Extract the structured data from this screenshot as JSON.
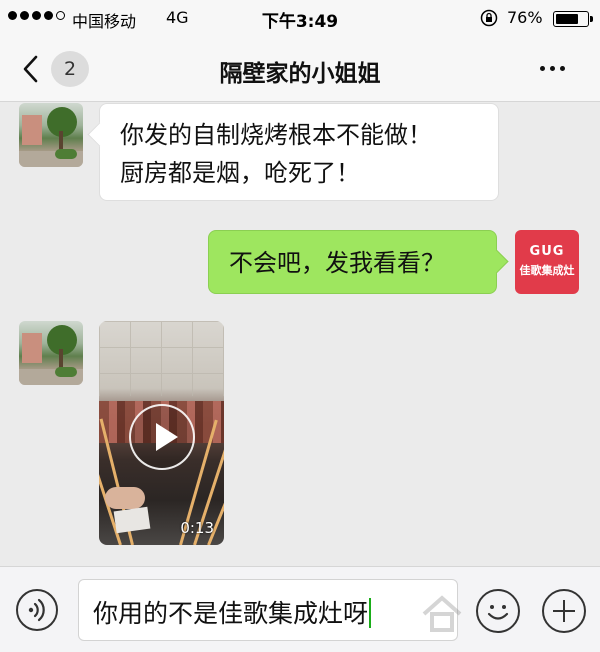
{
  "status_bar": {
    "carrier": "中国移动",
    "network": "4G",
    "time": "下午3:49",
    "battery_percent": "76%",
    "battery_level": 0.76
  },
  "nav": {
    "unread_count": "2",
    "title": "隔壁家的小姐姐",
    "icons": [
      "back-icon",
      "more-icon"
    ]
  },
  "messages": [
    {
      "side": "left",
      "type": "text",
      "lines": [
        "你发的自制烧烤根本不能做！",
        "厨房都是烟，呛死了！"
      ]
    },
    {
      "side": "right",
      "type": "text",
      "text": "不会吧，发我看看？",
      "avatar_logo": "GUG",
      "avatar_name": "佳歌集成灶"
    },
    {
      "side": "left",
      "type": "video",
      "duration": "0:13"
    }
  ],
  "input_bar": {
    "value": "你用的不是佳歌集成灶呀",
    "icons": [
      "voice-icon",
      "emoji-icon",
      "plus-icon"
    ]
  },
  "colors": {
    "sent_bubble": "#9ee65f",
    "received_bubble": "#ffffff",
    "chat_background": "#ebebeb",
    "brand_avatar": "#e13b4a",
    "caret": "#1aad19"
  }
}
